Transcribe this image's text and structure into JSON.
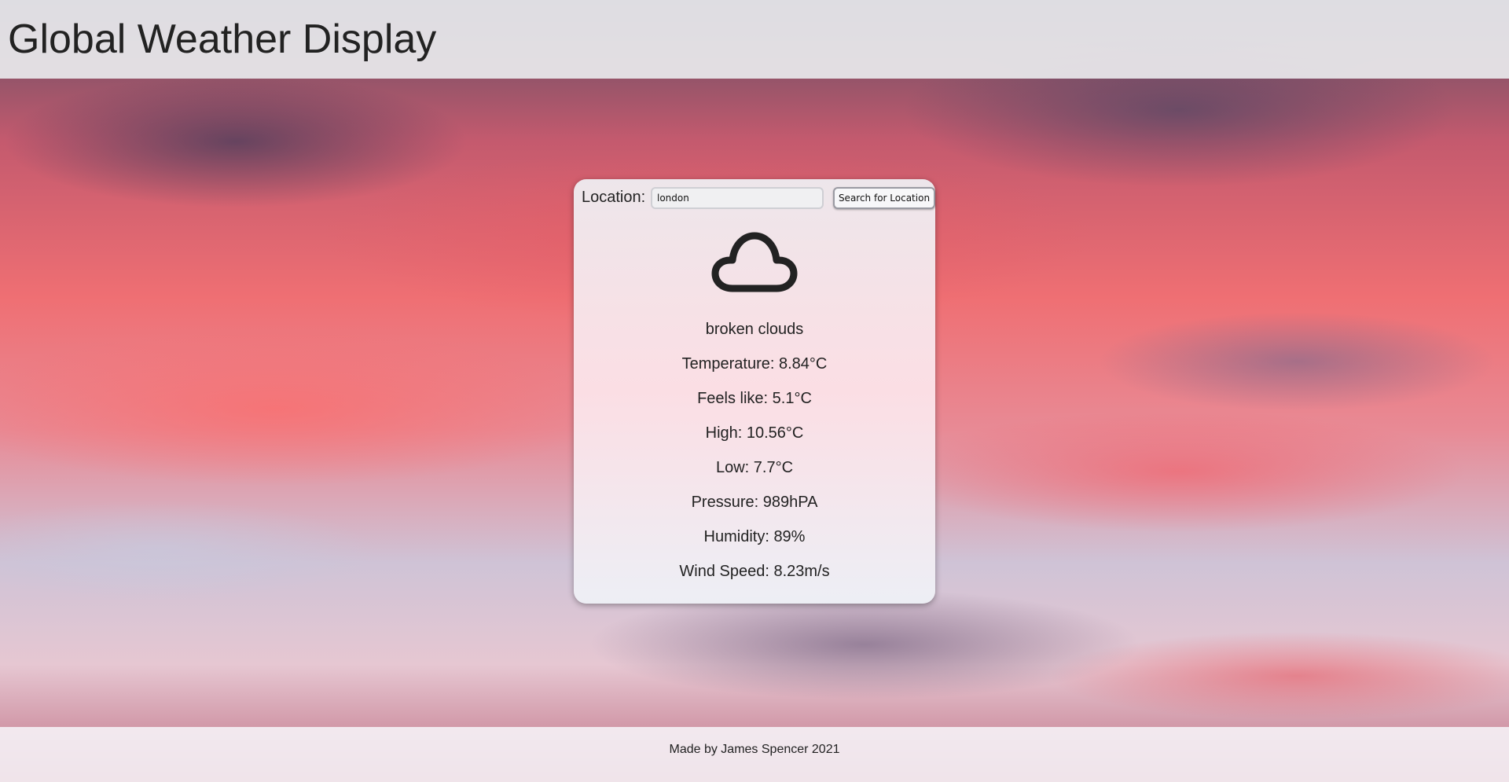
{
  "header": {
    "title": "Global Weather Display"
  },
  "search": {
    "label": "Location:",
    "value": "london",
    "button_label": "Search for Location"
  },
  "weather": {
    "icon": "cloud-icon",
    "description": "broken clouds",
    "temperature": "Temperature: 8.84°C",
    "feels_like": "Feels like: 5.1°C",
    "high": "High: 10.56°C",
    "low": "Low: 7.7°C",
    "pressure": "Pressure: 989hPA",
    "humidity": "Humidity: 89%",
    "wind_speed": "Wind Speed: 8.23m/s"
  },
  "footer": {
    "credit": "Made by James Spencer 2021"
  }
}
